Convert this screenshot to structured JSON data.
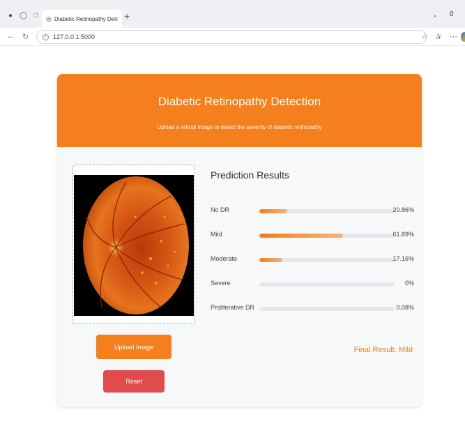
{
  "browser": {
    "tab_title": "Diabetic Retinopathy Detection",
    "tab_close": "x",
    "new_tab": "+",
    "url": "127.0.0.1:5000",
    "window_min": "-",
    "window_max": "0"
  },
  "header": {
    "title": "Diabetic Retinopathy Detection",
    "subtitle": "Upload a retinal image to detect the severity of diabetic retinopathy"
  },
  "upload": {
    "button_label": "Upload Image",
    "reset_label": "Reset"
  },
  "predictions": {
    "title": "Prediction Results",
    "items": [
      {
        "label": "No DR",
        "value": "20.86%",
        "fraction": 0.2086
      },
      {
        "label": "Mild",
        "value": "61.89%",
        "fraction": 0.6189
      },
      {
        "label": "Moderate",
        "value": "17.16%",
        "fraction": 0.1716
      },
      {
        "label": "Severe",
        "value": "0%",
        "fraction": 0.0
      },
      {
        "label": "Proliferative DR",
        "value": "0.08%",
        "fraction": 0.0008
      }
    ],
    "final_result": "Final Result: Mild"
  },
  "colors": {
    "accent": "#f57e1d",
    "reset": "#e14b4b"
  }
}
